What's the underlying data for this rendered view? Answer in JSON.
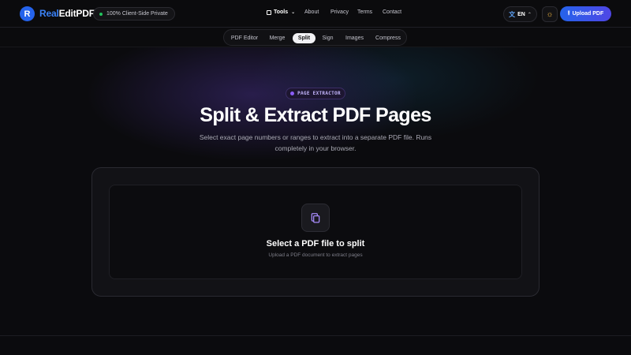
{
  "brand": {
    "logo_letter": "R",
    "name_accent": "Real",
    "name_rest": "EditPDF"
  },
  "privacy_badge": "100% Client-Side Private",
  "nav": {
    "tools": "Tools",
    "about": "About",
    "privacy": "Privacy",
    "terms": "Terms",
    "contact": "Contact"
  },
  "language": {
    "code": "EN"
  },
  "upload_button": "Upload PDF",
  "tabs": [
    {
      "label": "PDF Editor"
    },
    {
      "label": "Merge"
    },
    {
      "label": "Split",
      "active": true
    },
    {
      "label": "Sign"
    },
    {
      "label": "Images"
    },
    {
      "label": "Compress"
    }
  ],
  "hero": {
    "badge": "PAGE EXTRACTOR",
    "title": "Split & Extract PDF Pages",
    "description": "Select exact page numbers or ranges to extract into a separate PDF file. Runs completely in your browser."
  },
  "dropzone": {
    "title": "Select a PDF file to split",
    "subtitle": "Upload a PDF document to extract pages"
  },
  "colors": {
    "accent_blue": "#3b82f6",
    "upload_gradient_start": "#2563eb",
    "upload_gradient_end": "#4f46e5",
    "badge_purple": "#8b5cf6",
    "status_green": "#22c55e",
    "icon_purple": "#a78bfa"
  },
  "icons": {
    "logo": "r-logo-icon",
    "privacy_status": "status-dot-icon",
    "tools": "tools-icon",
    "tools_chevron": "chevron-down-icon",
    "language": "translate-icon",
    "language_chevron": "chevron-up-icon",
    "theme": "sun-icon",
    "upload": "upload-icon",
    "dropzone_file": "copy-files-icon"
  }
}
